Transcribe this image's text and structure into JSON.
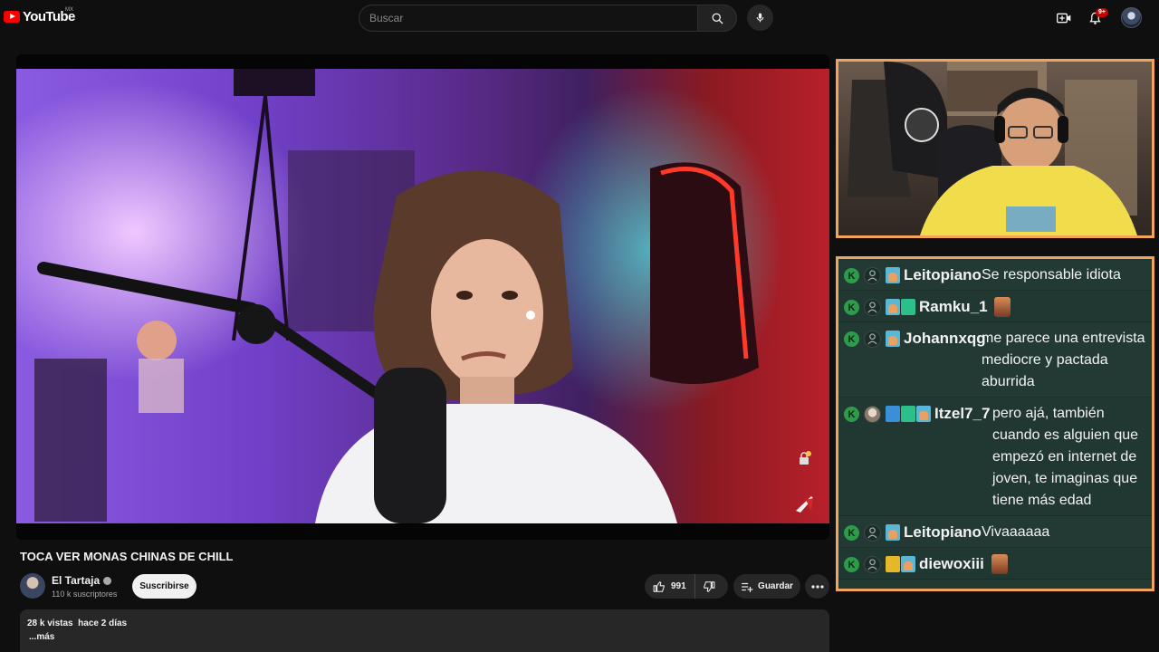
{
  "header": {
    "logo_text": "YouTube",
    "logo_region": "MX",
    "search_placeholder": "Buscar",
    "notifications_badge": "9+"
  },
  "video": {
    "title": "TOCA VER MONAS CHINAS DE CHILL",
    "channel_name": "El Tartaja",
    "subscribers": "110 k suscriptores",
    "subscribe_label": "Suscribirse",
    "likes": "991",
    "save_label": "Guardar",
    "views": "28 k vistas",
    "age": "hace 2 días",
    "more_label": "...más"
  },
  "chat": {
    "messages": [
      {
        "user": "Leitopiano",
        "text": "Se responsable idiota"
      },
      {
        "user": "Ramku_1",
        "text": ""
      },
      {
        "user": "Johannxqg",
        "text": "me parece una entrevista mediocre y pactada aburrida"
      },
      {
        "user": "Itzel7_7",
        "text": "pero ajá, también cuando es alguien que empezó en internet de joven, te imaginas que tiene más edad"
      },
      {
        "user": "Leitopiano",
        "text": "Vivaaaaaa"
      },
      {
        "user": "diewoxiii",
        "text": ""
      }
    ]
  },
  "colors": {
    "background": "#0f0f0f",
    "accent_red": "#ff0000",
    "overlay_border": "#f2a55a",
    "chat_bg": "#233a34"
  },
  "icons": [
    "youtube-logo-icon",
    "search-icon",
    "mic-icon",
    "create-icon",
    "bell-icon",
    "verified-icon",
    "like-icon",
    "dislike-icon",
    "save-playlist-icon",
    "more-icon"
  ]
}
